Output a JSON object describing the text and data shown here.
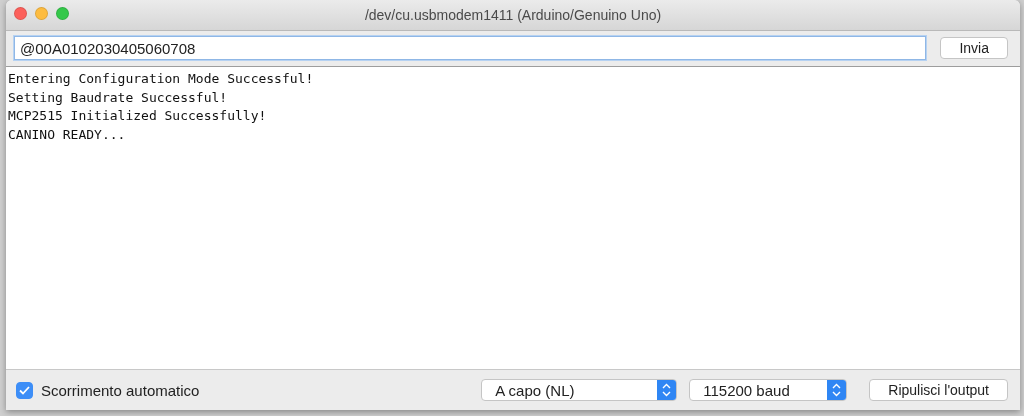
{
  "window": {
    "title": "/dev/cu.usbmodem1411 (Arduino/Genuino Uno)"
  },
  "input": {
    "value": "@00A0102030405060708",
    "focused": true
  },
  "send_button": "Invia",
  "output_lines": [
    "Entering Configuration Mode Successful!",
    "Setting Baudrate Successful!",
    "MCP2515 Initialized Successfully!",
    "CANINO READY..."
  ],
  "autoscroll": {
    "label": "Scorrimento automatico",
    "checked": true
  },
  "line_ending": "A capo (NL)",
  "baud_rate": "115200 baud",
  "clear_button": "Ripulisci l'output"
}
